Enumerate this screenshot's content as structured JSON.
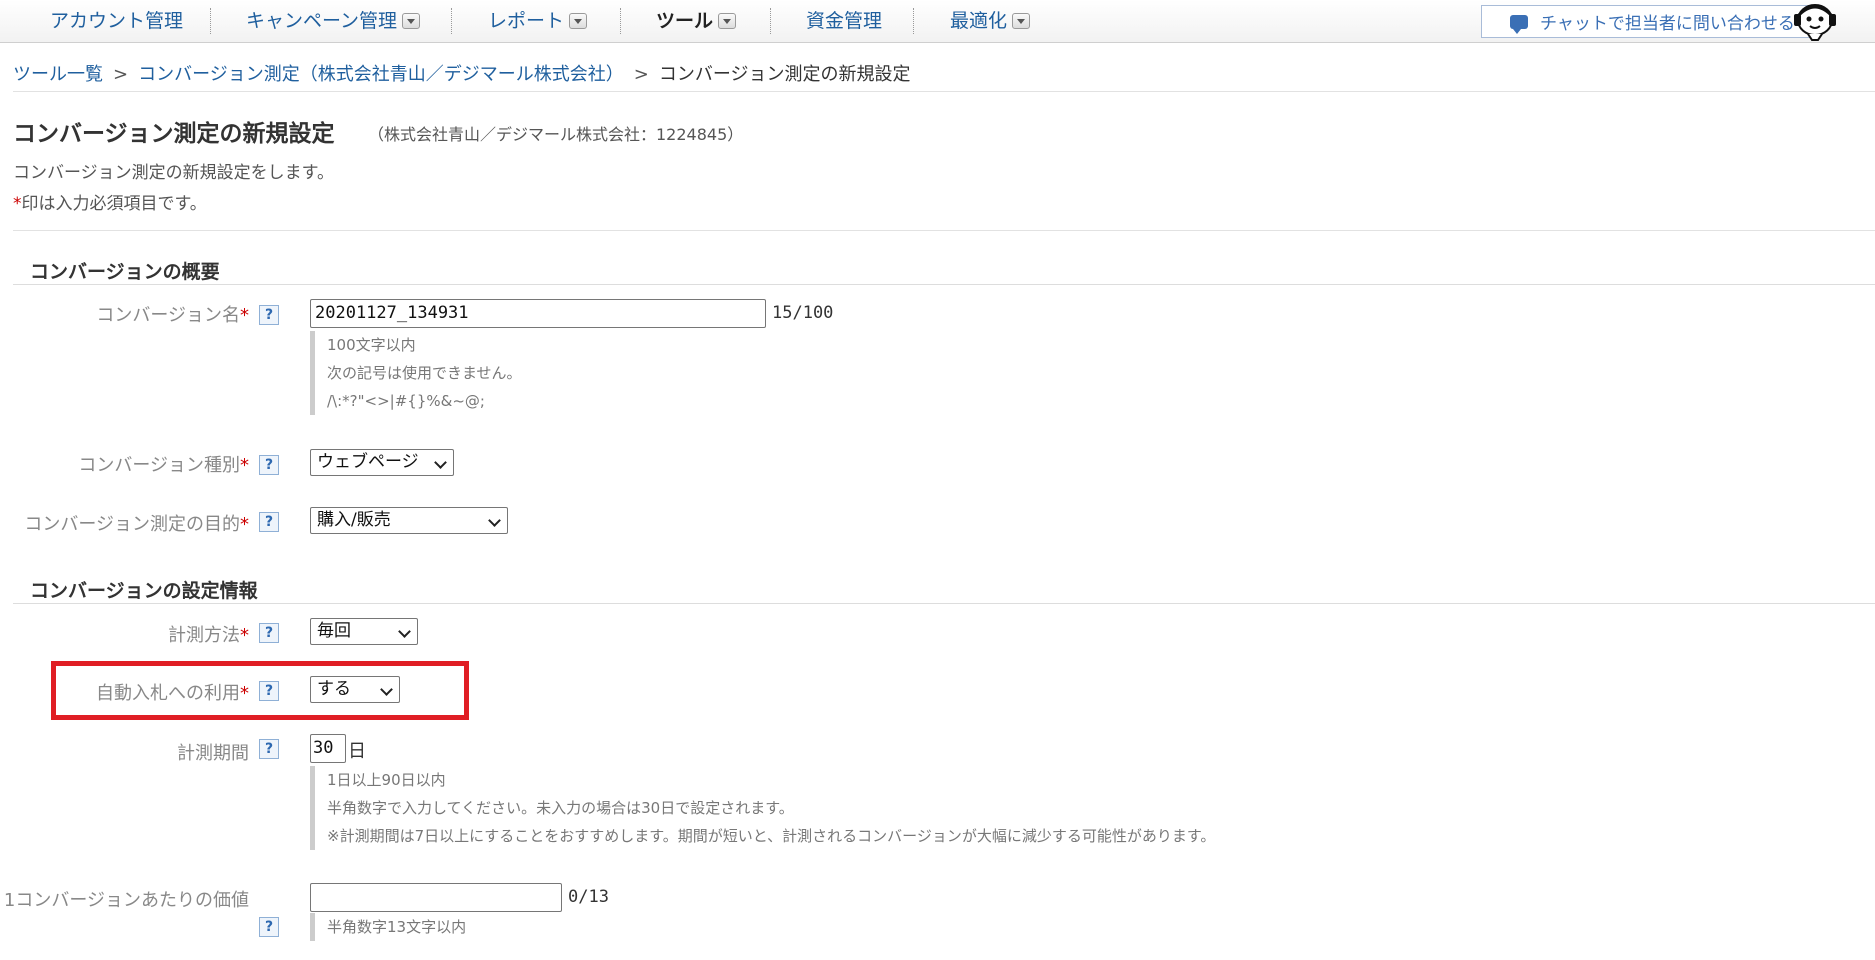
{
  "nav": {
    "items": [
      {
        "label": "アカウント管理",
        "has_menu": false,
        "active": false
      },
      {
        "label": "キャンペーン管理",
        "has_menu": true,
        "active": false
      },
      {
        "label": "レポート",
        "has_menu": true,
        "active": false
      },
      {
        "label": "ツール",
        "has_menu": true,
        "active": true
      },
      {
        "label": "資金管理",
        "has_menu": false,
        "active": false
      },
      {
        "label": "最適化",
        "has_menu": true,
        "active": false
      }
    ],
    "chat_label": "チャットで担当者に問い合わせる"
  },
  "breadcrumb": {
    "items": [
      "ツール一覧",
      "コンバージョン測定（株式会社青山／デジマール株式会社）",
      "コンバージョン測定の新規設定"
    ],
    "separator": ">"
  },
  "header": {
    "title": "コンバージョン測定の新規設定",
    "subtitle": "（株式会社青山／デジマール株式会社：1224845）",
    "description": "コンバージョン測定の新規設定をします。",
    "required_mark": "*",
    "required_note": "印は入力必須項目です。"
  },
  "help_label": "?",
  "sections": {
    "overview": {
      "title": "コンバージョンの概要",
      "conversion_name": {
        "label": "コンバージョン名",
        "value": "20201127_134931",
        "counter": "15/100",
        "hints": [
          "100文字以内",
          "次の記号は使用できません。",
          "/\\:*?\"<>|#{}%&~@;"
        ]
      },
      "conversion_type": {
        "label": "コンバージョン種別",
        "value": "ウェブページ"
      },
      "purpose": {
        "label": "コンバージョン測定の目的",
        "value": "購入/販売"
      }
    },
    "settings": {
      "title": "コンバージョンの設定情報",
      "method": {
        "label": "計測方法",
        "value": "毎回"
      },
      "auto_bid": {
        "label": "自動入札への利用",
        "value": "する"
      },
      "period": {
        "label": "計測期間",
        "value": "30",
        "unit": "日",
        "hints": [
          "1日以上90日以内",
          "半角数字で入力してください。未入力の場合は30日で設定されます。",
          "※計測期間は7日以上にすることをおすすめします。期間が短いと、計測されるコンバージョンが大幅に減少する可能性があります。"
        ]
      },
      "value_per_conversion": {
        "label": "1コンバージョンあたりの価値",
        "value": "",
        "counter": "0/13",
        "hints": [
          "半角数字13文字以内"
        ]
      }
    }
  },
  "colors": {
    "link": "#1f5f9e",
    "required": "#cc0000",
    "highlight": "#e01e24"
  }
}
